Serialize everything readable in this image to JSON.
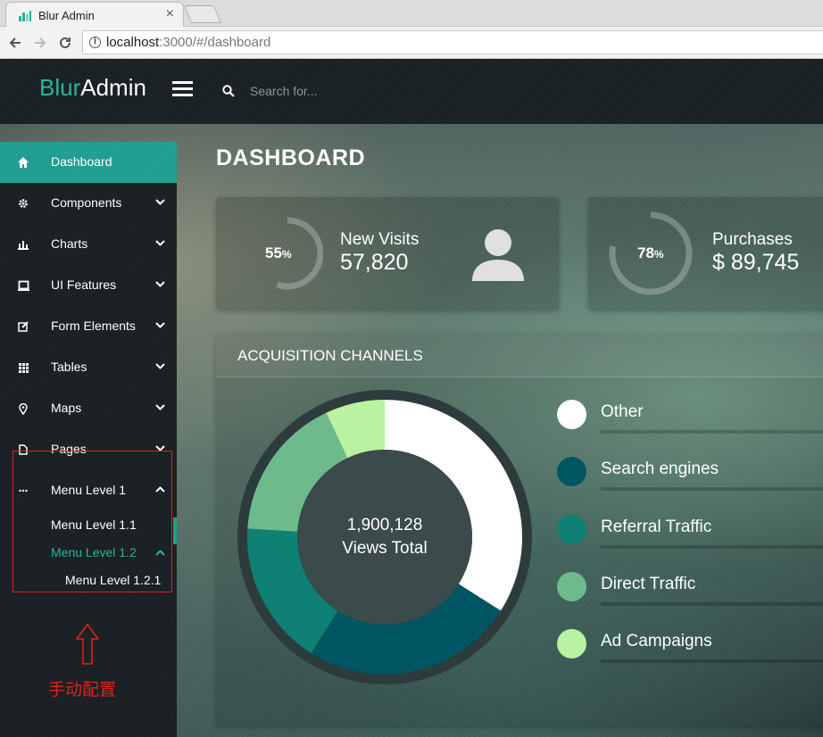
{
  "browser": {
    "tab_title": "Blur Admin",
    "url_host": "localhost",
    "url_rest": ":3000/#/dashboard"
  },
  "app": {
    "logo_primary": "Blur",
    "logo_secondary": "Admin",
    "search_placeholder": "Search for...",
    "accent_color": "#209e91"
  },
  "sidebar": {
    "items": [
      {
        "label": "Dashboard",
        "icon": "home-icon",
        "active": true
      },
      {
        "label": "Components",
        "icon": "gear-icon"
      },
      {
        "label": "Charts",
        "icon": "bar-chart-icon"
      },
      {
        "label": "UI Features",
        "icon": "laptop-icon"
      },
      {
        "label": "Form Elements",
        "icon": "edit-icon"
      },
      {
        "label": "Tables",
        "icon": "grid-icon"
      },
      {
        "label": "Maps",
        "icon": "map-pin-icon"
      },
      {
        "label": "Pages",
        "icon": "file-icon"
      },
      {
        "label": "Menu Level 1",
        "icon": "more-icon"
      }
    ],
    "sub_items": {
      "level_1_1": "Menu Level 1.1",
      "level_1_2": "Menu Level 1.2",
      "level_1_2_1": "Menu Level 1.2.1"
    },
    "annotation": "手动配置",
    "annotation_color": "#e3211c"
  },
  "page": {
    "title": "DASHBOARD"
  },
  "stats": [
    {
      "percent": "55",
      "percent_unit": "%",
      "percent_value": 0.55,
      "label": "New Visits",
      "value": "57,820",
      "icon": "person-icon"
    },
    {
      "percent": "78",
      "percent_unit": "%",
      "percent_value": 0.78,
      "label": "Purchases",
      "value": "$ 89,745"
    }
  ],
  "channels": {
    "title": "ACQUISITION CHANNELS",
    "total_value": "1,900,128",
    "total_label": "Views Total",
    "legend": [
      {
        "label": "Other",
        "color": "#ffffff"
      },
      {
        "label": "Search engines",
        "color": "#005562"
      },
      {
        "label": "Referral Traffic",
        "color": "#0e8174"
      },
      {
        "label": "Direct Traffic",
        "color": "#6eba8c"
      },
      {
        "label": "Ad Campaigns",
        "color": "#b9f2a1"
      }
    ]
  },
  "chart_data": {
    "type": "pie",
    "categories": [
      "Other",
      "Search engines",
      "Referral Traffic",
      "Direct Traffic",
      "Ad Campaigns"
    ],
    "values": [
      34,
      25,
      17,
      17,
      7
    ],
    "colors": [
      "#ffffff",
      "#005562",
      "#0e8174",
      "#6eba8c",
      "#b9f2a1"
    ],
    "center_text": [
      "1,900,128",
      "Views Total"
    ]
  }
}
